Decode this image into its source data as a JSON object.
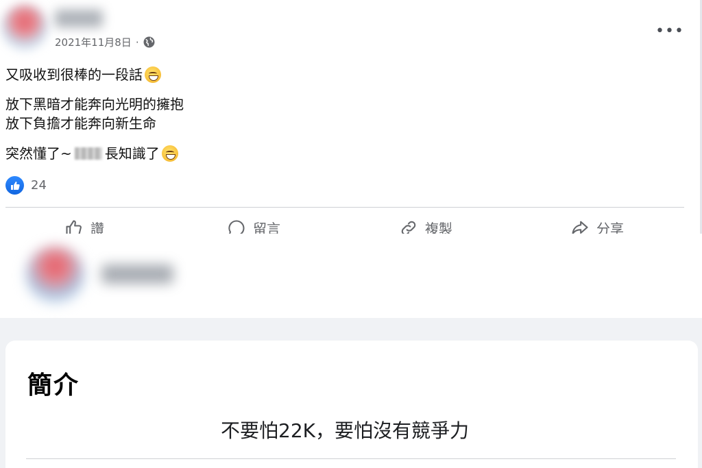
{
  "post": {
    "date": "2021年11月8日",
    "dot": "·",
    "more": "•••",
    "lines": [
      "又吸收到很棒的一段話",
      "放下黑暗才能奔向光明的擁抱",
      "放下負擔才能奔向新生命"
    ],
    "last_line_start": "突然懂了~",
    "last_line_end": "長知識了",
    "like_count": "24",
    "actions": {
      "like": "讚",
      "comment": "留言",
      "copy": "複製",
      "share": "分享"
    }
  },
  "intro": {
    "title": "簡介",
    "bio": "不要怕22K，要怕沒有競爭力"
  },
  "icons": {
    "like_badge": "thumbs-up-icon",
    "globe": "globe-icon"
  },
  "colors": {
    "accent": "#1877f2",
    "muted": "#65676b",
    "page_bg": "#f0f2f5"
  }
}
